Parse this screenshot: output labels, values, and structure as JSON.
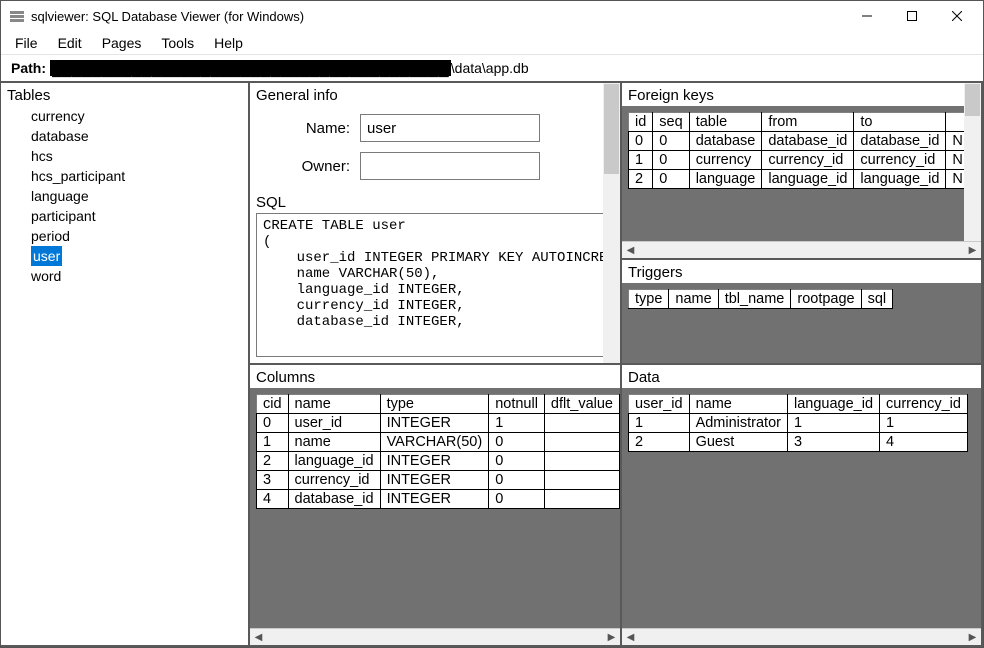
{
  "window": {
    "title": "sqlviewer: SQL Database Viewer (for Windows)"
  },
  "menu": [
    "File",
    "Edit",
    "Pages",
    "Tools",
    "Help"
  ],
  "path": {
    "label": "Path:",
    "hidden": "████████████████████████████████████████",
    "tail": "\\data\\app.db"
  },
  "tables": {
    "heading": "Tables",
    "items": [
      "currency",
      "database",
      "hcs",
      "hcs_participant",
      "language",
      "participant",
      "period",
      "user",
      "word"
    ],
    "selected": "user"
  },
  "general": {
    "heading": "General info",
    "name_label": "Name:",
    "name_value": "user",
    "owner_label": "Owner:",
    "owner_value": "",
    "sql_label": "SQL",
    "sql": "CREATE TABLE user\n(\n    user_id INTEGER PRIMARY KEY AUTOINCREMENT NOT NULL,\n    name VARCHAR(50),\n    language_id INTEGER,\n    currency_id INTEGER,\n    database_id INTEGER,"
  },
  "foreign_keys": {
    "heading": "Foreign keys",
    "headers": [
      "id",
      "seq",
      "table",
      "from",
      "to",
      ""
    ],
    "rows": [
      [
        "0",
        "0",
        "database",
        "database_id",
        "database_id",
        "N"
      ],
      [
        "1",
        "0",
        "currency",
        "currency_id",
        "currency_id",
        "N"
      ],
      [
        "2",
        "0",
        "language",
        "language_id",
        "language_id",
        "N"
      ]
    ]
  },
  "triggers": {
    "heading": "Triggers",
    "headers": [
      "type",
      "name",
      "tbl_name",
      "rootpage",
      "sql"
    ]
  },
  "columns": {
    "heading": "Columns",
    "headers": [
      "cid",
      "name",
      "type",
      "notnull",
      "dflt_value"
    ],
    "rows": [
      [
        "0",
        "user_id",
        "INTEGER",
        "1",
        ""
      ],
      [
        "1",
        "name",
        "VARCHAR(50)",
        "0",
        ""
      ],
      [
        "2",
        "language_id",
        "INTEGER",
        "0",
        ""
      ],
      [
        "3",
        "currency_id",
        "INTEGER",
        "0",
        ""
      ],
      [
        "4",
        "database_id",
        "INTEGER",
        "0",
        ""
      ]
    ]
  },
  "data": {
    "heading": "Data",
    "headers": [
      "user_id",
      "name",
      "language_id",
      "currency_id"
    ],
    "rows": [
      [
        "1",
        "Administrator",
        "1",
        "1"
      ],
      [
        "2",
        "Guest",
        "3",
        "4"
      ]
    ]
  }
}
